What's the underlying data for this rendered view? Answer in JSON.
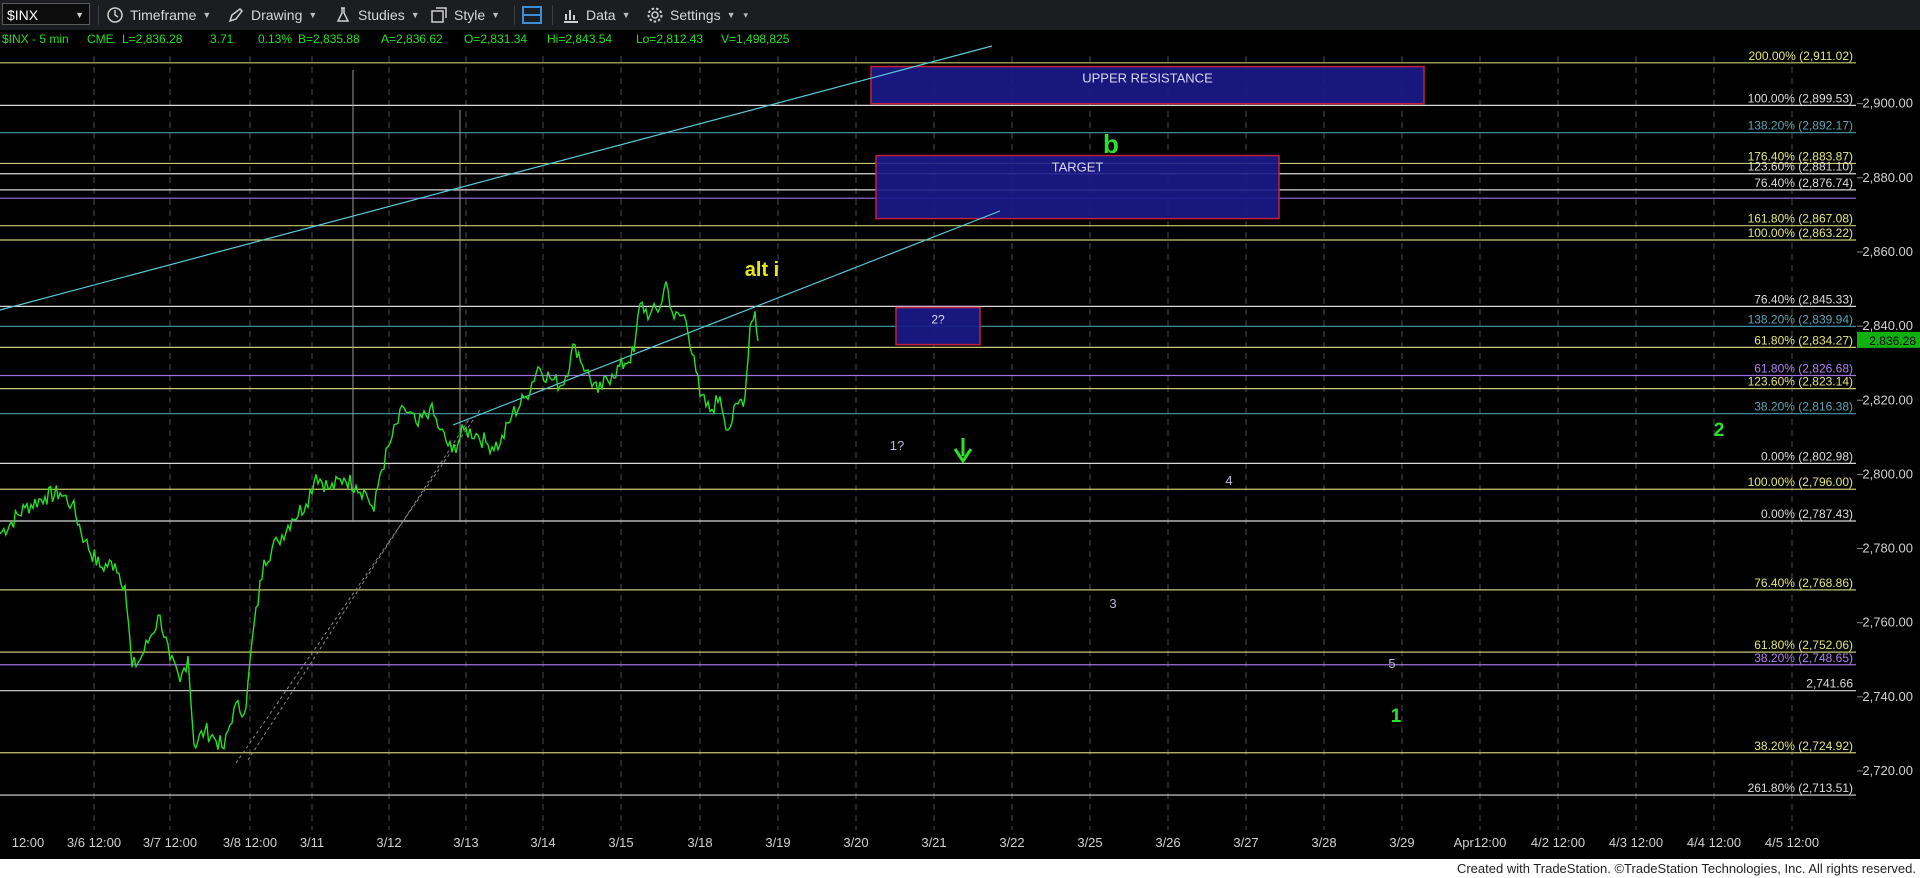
{
  "toolbar": {
    "symbol": "$INX",
    "timeframe": "Timeframe",
    "drawing": "Drawing",
    "studies": "Studies",
    "style": "Style",
    "data": "Data",
    "settings": "Settings"
  },
  "infobar": {
    "symbol": "$INX - 5 min",
    "exchange": "CME",
    "last": "L=2,836.28",
    "change": "3.71",
    "change_pct": "0.13%",
    "bid": "B=2,835.88",
    "ask": "A=2,836.62",
    "open": "O=2,831.34",
    "high": "Hi=2,843.54",
    "low": "Lo=2,812.43",
    "volume": "V=1,498,825"
  },
  "footer": "Created with TradeStation. ©TradeStation Technologies, Inc. All rights reserved.",
  "chart_data": {
    "type": "line",
    "ylim": [
      2708,
      2918
    ],
    "price_ticks": [
      "2,720.00",
      "2,740.00",
      "2,760.00",
      "2,780.00",
      "2,800.00",
      "2,820.00",
      "2,840.00",
      "2,860.00",
      "2,880.00",
      "2,900.00"
    ],
    "date_labels": [
      "12:00",
      "3/6 12:00",
      "3/7 12:00",
      "3/8 12:00",
      "3/11",
      "3/12",
      "3/13",
      "3/14",
      "3/15",
      "3/18",
      "3/19",
      "3/20",
      "3/21",
      "3/22",
      "3/25",
      "3/26",
      "3/27",
      "3/28",
      "3/29",
      "Apr12:00",
      "4/2 12:00",
      "4/3 12:00",
      "4/4 12:00",
      "4/5 12:00"
    ],
    "last_price": "2,836.28",
    "colors": {
      "price": "#22e022",
      "wave_label": "#2ee02e",
      "yellow": "#e8e814",
      "fib_yellow": "#c8c870",
      "fib_white": "#d8d8d8",
      "fib_purple": "#a070e0",
      "fib_blue": "#4a9aa8",
      "trendline": "#5cc8d8",
      "box_fill": "#1a1a8c",
      "box_border": "#c02040"
    },
    "fib_levels": [
      {
        "label": "200.00% (2,911.02)",
        "price": 2911.02,
        "color": "yellow"
      },
      {
        "label": "100.00% (2,899.53)",
        "price": 2899.53,
        "color": "white"
      },
      {
        "label": "138.20% (2,892.17)",
        "price": 2892.17,
        "color": "blue"
      },
      {
        "label": "176.40% (2,883.87)",
        "price": 2883.87,
        "color": "yellow"
      },
      {
        "label": "123.60% (2,881.10)",
        "price": 2881.1,
        "color": "white"
      },
      {
        "label": "76.40% (2,876.74)",
        "price": 2876.74,
        "color": "white"
      },
      {
        "label": "",
        "price": 2874.5,
        "color": "purple"
      },
      {
        "label": "161.80% (2,867.08)",
        "price": 2867.08,
        "color": "yellow"
      },
      {
        "label": "100.00% (2,863.22)",
        "price": 2863.22,
        "color": "yellow"
      },
      {
        "label": "76.40% (2,845.33)",
        "price": 2845.33,
        "color": "white"
      },
      {
        "label": "138.20% (2,839.94)",
        "price": 2839.94,
        "color": "blue"
      },
      {
        "label": "61.80% (2,834.27)",
        "price": 2834.27,
        "color": "yellow"
      },
      {
        "label": "61.80% (2,826.68)",
        "price": 2826.68,
        "color": "purple"
      },
      {
        "label": "123.60% (2,823.14)",
        "price": 2823.14,
        "color": "yellow"
      },
      {
        "label": "38.20% (2,816.38)",
        "price": 2816.38,
        "color": "blue"
      },
      {
        "label": "0.00% (2,802.98)",
        "price": 2802.98,
        "color": "white"
      },
      {
        "label": "100.00% (2,796.00)",
        "price": 2796.0,
        "color": "yellow"
      },
      {
        "label": "0.00% (2,787.43)",
        "price": 2787.43,
        "color": "white"
      },
      {
        "label": "76.40% (2,768.86)",
        "price": 2768.86,
        "color": "yellow"
      },
      {
        "label": "61.80% (2,752.06)",
        "price": 2752.06,
        "color": "yellow"
      },
      {
        "label": "38.20% (2,748.65)",
        "price": 2748.65,
        "color": "purple"
      },
      {
        "label": "2,741.66",
        "price": 2741.66,
        "color": "white"
      },
      {
        "label": "38.20% (2,724.92)",
        "price": 2724.92,
        "color": "yellow"
      },
      {
        "label": "261.80% (2,713.51)",
        "price": 2713.51,
        "color": "white"
      }
    ],
    "boxes": [
      {
        "label": "UPPER RESISTANCE",
        "top": 2910,
        "bottom": 2900
      },
      {
        "label": "TARGET",
        "top": 2886,
        "bottom": 2869
      },
      {
        "label": "2?",
        "top": 2845,
        "bottom": 2835
      }
    ],
    "annotations": [
      {
        "text": "alt i",
        "kind": "yellow"
      },
      {
        "text": "b",
        "kind": "green"
      },
      {
        "text": "2",
        "kind": "green"
      },
      {
        "text": "1",
        "kind": "green"
      },
      {
        "text": "1?",
        "kind": "white"
      },
      {
        "text": "4",
        "kind": "white"
      },
      {
        "text": "3",
        "kind": "white"
      },
      {
        "text": "5",
        "kind": "white"
      }
    ],
    "price_path": [
      [
        0,
        2784
      ],
      [
        25,
        2791
      ],
      [
        45,
        2794
      ],
      [
        60,
        2795
      ],
      [
        72,
        2792
      ],
      [
        85,
        2782
      ],
      [
        100,
        2775
      ],
      [
        115,
        2776
      ],
      [
        125,
        2770
      ],
      [
        132,
        2748
      ],
      [
        140,
        2750
      ],
      [
        150,
        2756
      ],
      [
        160,
        2762
      ],
      [
        170,
        2750
      ],
      [
        180,
        2744
      ],
      [
        188,
        2751
      ],
      [
        194,
        2727
      ],
      [
        205,
        2731
      ],
      [
        214,
        2729
      ],
      [
        224,
        2726
      ],
      [
        234,
        2737
      ],
      [
        246,
        2737
      ],
      [
        252,
        2755
      ],
      [
        264,
        2777
      ],
      [
        278,
        2782
      ],
      [
        292,
        2788
      ],
      [
        306,
        2792
      ],
      [
        316,
        2800
      ],
      [
        330,
        2796
      ],
      [
        344,
        2799
      ],
      [
        356,
        2797
      ],
      [
        366,
        2795
      ],
      [
        374,
        2790
      ],
      [
        380,
        2800
      ],
      [
        392,
        2810
      ],
      [
        404,
        2818
      ],
      [
        418,
        2813
      ],
      [
        430,
        2818
      ],
      [
        440,
        2812
      ],
      [
        452,
        2806
      ],
      [
        464,
        2812
      ],
      [
        476,
        2811
      ],
      [
        488,
        2808
      ],
      [
        500,
        2808
      ],
      [
        512,
        2816
      ],
      [
        526,
        2821
      ],
      [
        538,
        2829
      ],
      [
        550,
        2826
      ],
      [
        562,
        2824
      ],
      [
        575,
        2835
      ],
      [
        586,
        2828
      ],
      [
        598,
        2822
      ],
      [
        612,
        2827
      ],
      [
        625,
        2830
      ],
      [
        634,
        2833
      ],
      [
        640,
        2846
      ],
      [
        650,
        2843
      ],
      [
        660,
        2845
      ],
      [
        666,
        2852
      ],
      [
        674,
        2842
      ],
      [
        684,
        2843
      ],
      [
        694,
        2832
      ],
      [
        700,
        2821
      ],
      [
        710,
        2817
      ],
      [
        720,
        2821
      ],
      [
        728,
        2812
      ],
      [
        738,
        2819
      ],
      [
        745,
        2821
      ],
      [
        750,
        2840
      ],
      [
        755,
        2844
      ],
      [
        758,
        2836
      ]
    ]
  }
}
